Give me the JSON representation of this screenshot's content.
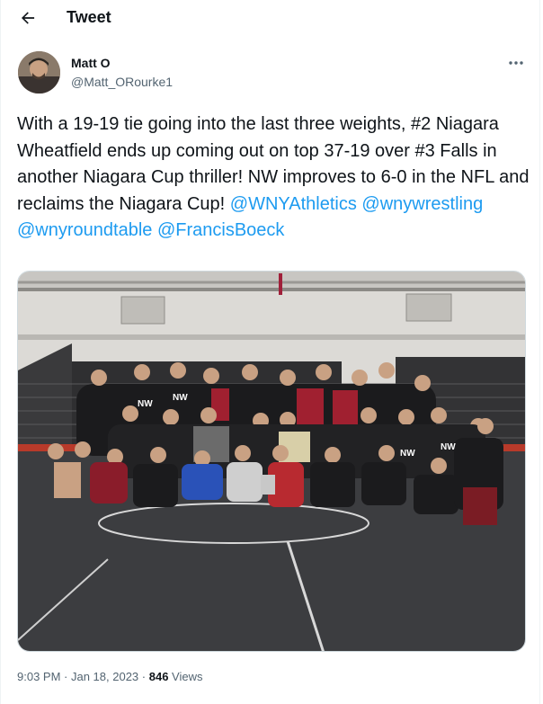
{
  "header": {
    "title": "Tweet"
  },
  "author": {
    "name": "Matt O",
    "handle": "@Matt_ORourke1"
  },
  "tweet": {
    "text_parts": [
      "With a 19-19 tie going into the last three weights, #2 Niagara Wheatfield ends up coming out on top 37-19 over #3 Falls in another Niagara Cup thriller! NW improves to 6-0 in the NFL and reclaims the Niagara Cup! ",
      "@WNYAthletics",
      " ",
      "@wnywrestling",
      " ",
      "@wnyroundtable",
      " ",
      "@FrancisBoeck"
    ]
  },
  "photo": {
    "jersey_text": "NW"
  },
  "meta": {
    "time": "9:03 PM",
    "sep1": " · ",
    "date": "Jan 18, 2023",
    "sep2": " · ",
    "views_count": "846",
    "views_label": " Views"
  },
  "colors": {
    "accent": "#1d9bf0",
    "muted": "#536471",
    "text": "#0f1419"
  },
  "icons": {
    "back": "arrow-left-icon",
    "more": "more-horizontal-icon"
  }
}
